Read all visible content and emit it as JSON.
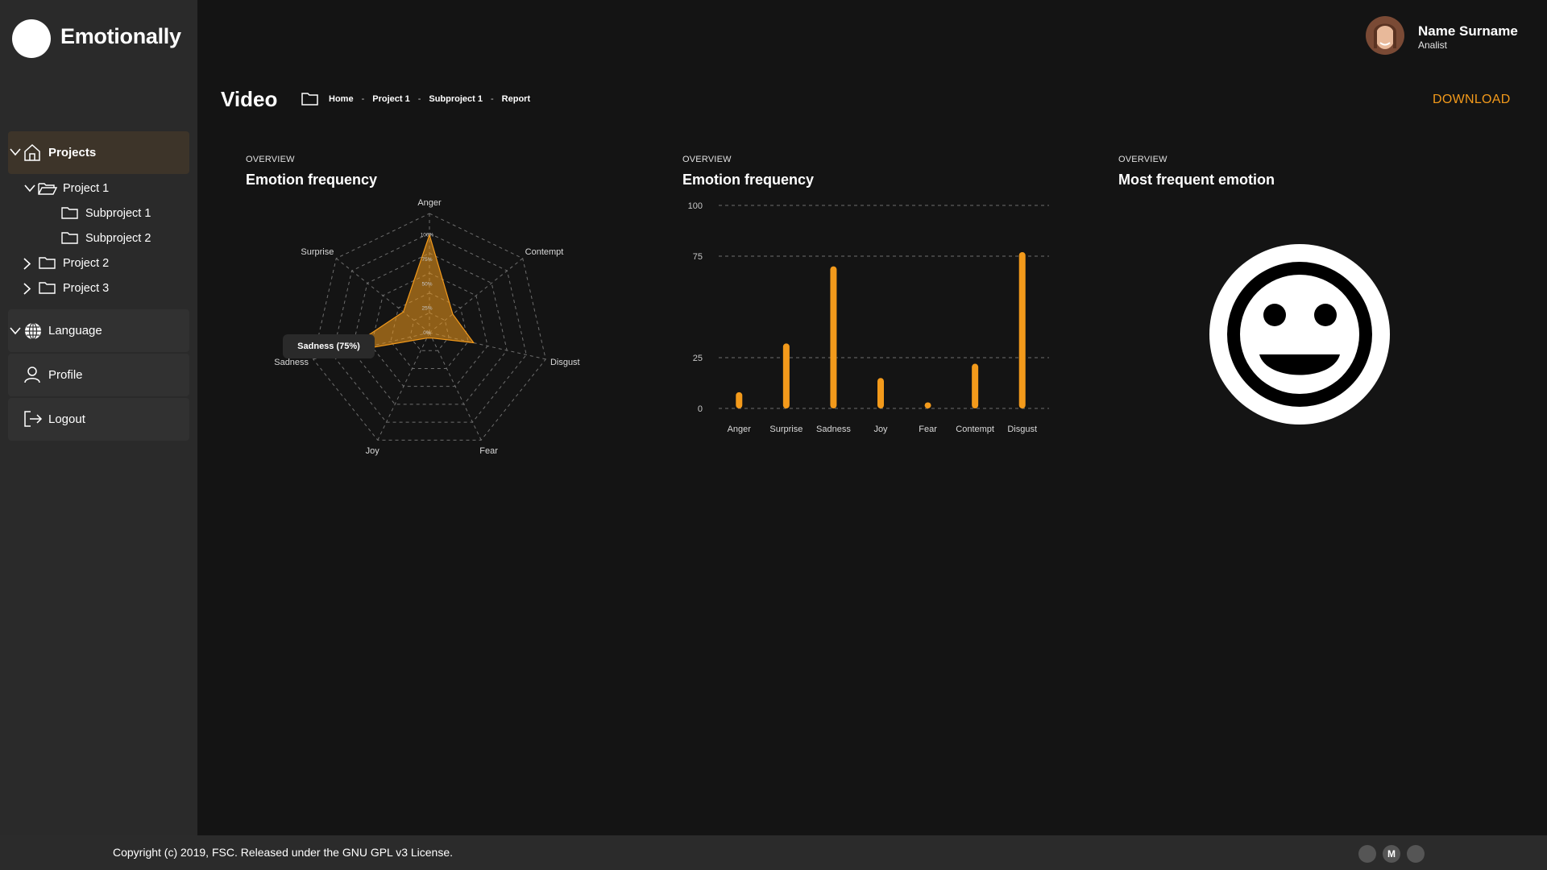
{
  "app": {
    "name": "Emotionally"
  },
  "user": {
    "name": "Name Surname",
    "role": "Analist"
  },
  "sidebar": {
    "projects_label": "Projects",
    "tree": [
      {
        "label": "Project 1",
        "expanded": true,
        "children": [
          "Subproject 1",
          "Subproject 2"
        ]
      },
      {
        "label": "Project 2",
        "expanded": false
      },
      {
        "label": "Project 3",
        "expanded": false
      }
    ],
    "language_label": "Language",
    "profile_label": "Profile",
    "logout_label": "Logout"
  },
  "page": {
    "title": "Video",
    "breadcrumb": [
      "Home",
      "Project 1",
      "Subproject 1",
      "Report"
    ],
    "breadcrumb_sep": "-",
    "download_label": "DOWNLOAD"
  },
  "cards": [
    {
      "kicker": "OVERVIEW",
      "title": "Emotion frequency"
    },
    {
      "kicker": "OVERVIEW",
      "title": "Emotion frequency"
    },
    {
      "kicker": "OVERVIEW",
      "title": "Most frequent emotion"
    }
  ],
  "colors": {
    "accent": "#f39a1b",
    "background": "#141414",
    "sidebar": "#2a2a2a"
  },
  "radar_tooltip": "Sadness (75%)",
  "most_frequent_emotion_icon": "smiley-face-icon",
  "footer": {
    "copyright": "Copyright (c) 2019, FSC. Released under the GNU GPL v3 License.",
    "social_middle": "M"
  },
  "chart_data": [
    {
      "type": "radar",
      "categories": [
        "Anger",
        "Contempt",
        "Disgust",
        "Fear",
        "Joy",
        "Sadness",
        "Surprise"
      ],
      "values": [
        82,
        25,
        38,
        5,
        5,
        75,
        28
      ],
      "rlim": [
        0,
        100
      ],
      "tick_labels": [
        "0%",
        "25%",
        "50%",
        "75%",
        "100%"
      ],
      "grid": true
    },
    {
      "type": "bar",
      "categories": [
        "Anger",
        "Surprise",
        "Sadness",
        "Joy",
        "Fear",
        "Contempt",
        "Disgust"
      ],
      "values": [
        8,
        32,
        70,
        15,
        3,
        22,
        77
      ],
      "ylim": [
        0,
        100
      ],
      "yticks": [
        0,
        25,
        75,
        100
      ],
      "grid": true
    }
  ]
}
